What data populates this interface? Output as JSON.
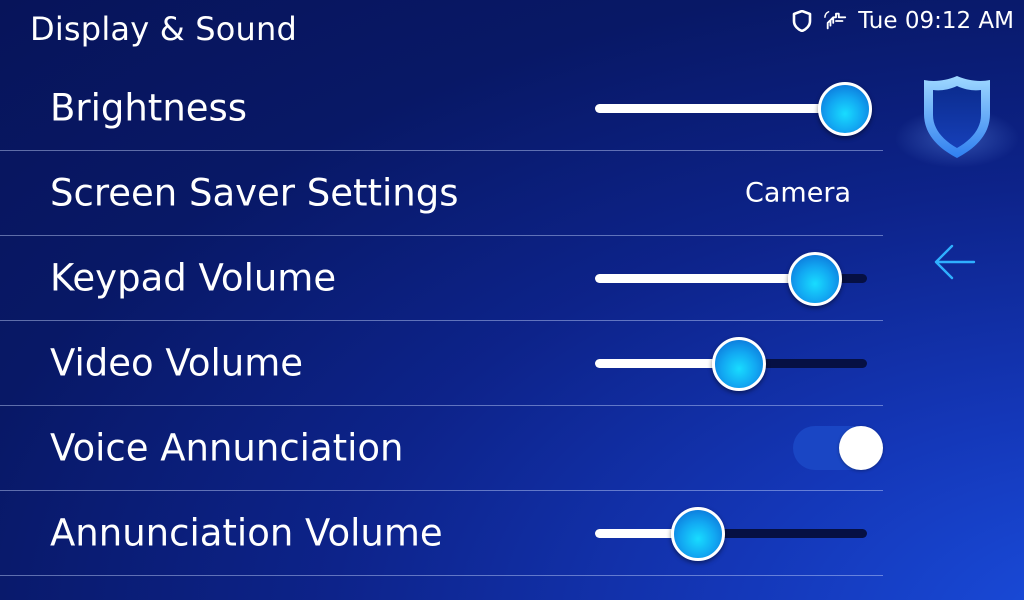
{
  "header": {
    "title": "Display & Sound"
  },
  "status_bar": {
    "icons": [
      "shield-status-icon",
      "hand-wave-icon"
    ],
    "day_time": "Tue 09:12 AM"
  },
  "settings": {
    "brightness": {
      "label": "Brightness",
      "value_percent": 92
    },
    "screen_saver": {
      "label": "Screen Saver Settings",
      "value": "Camera"
    },
    "keypad_volume": {
      "label": "Keypad Volume",
      "value_percent": 81
    },
    "video_volume": {
      "label": "Video Volume",
      "value_percent": 53
    },
    "voice_annunciation": {
      "label": "Voice Annunciation",
      "enabled": true
    },
    "annunciation_volume": {
      "label": "Annunciation Volume",
      "value_percent": 38
    }
  },
  "sidebar": {
    "logo_icon": "shield-logo-icon",
    "back_icon": "back-arrow-icon"
  },
  "colors": {
    "accent": "#12a8f2",
    "toggle_on_track": "#1a46c4",
    "background_dark": "#07145a",
    "background_light": "#1a4fe0"
  }
}
